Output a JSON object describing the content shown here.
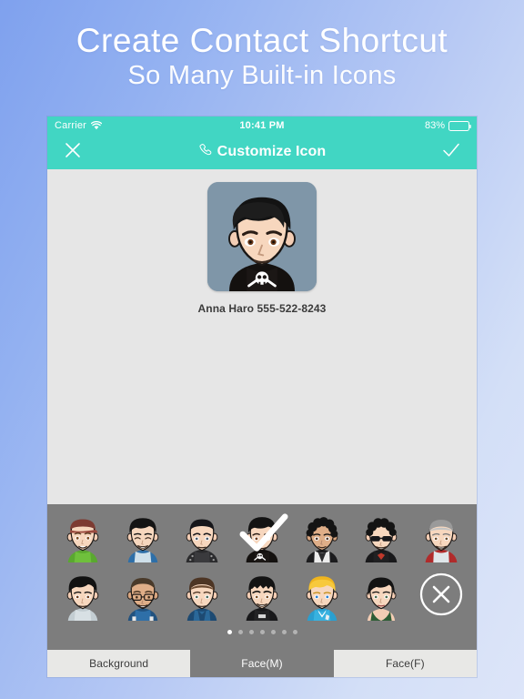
{
  "promo": {
    "line1": "Create Contact Shortcut",
    "line2": "So Many Built-in Icons"
  },
  "colors": {
    "nav_teal": "#41D6C3",
    "content_gray": "#E6E6E6",
    "picker_gray": "#7D7D7D",
    "tab_inactive": "#E8E8E6",
    "page_bg_start": "#7FA1EE",
    "page_bg_end": "#DDE5F9"
  },
  "statusbar": {
    "carrier": "Carrier",
    "wifi_icon": "wifi-icon",
    "time": "10:41 PM",
    "battery_percent": "83%",
    "battery_level": 83,
    "battery_icon": "battery-icon"
  },
  "navbar": {
    "close_icon": "close-icon",
    "title": "Customize Icon",
    "title_icon": "phone-handset-icon",
    "done_icon": "checkmark-icon"
  },
  "preview": {
    "label": "Anna Haro 555-522-8243",
    "avatar_name": "avatar-beanie-skull-tee",
    "background_color": "#7F96A8"
  },
  "picker": {
    "rows": [
      [
        {
          "name": "avatar-maroon-cap-green-shirt",
          "selected": false
        },
        {
          "name": "avatar-black-hair-blue-shirt",
          "selected": false
        },
        {
          "name": "avatar-buzzcut-black-jacket",
          "selected": false
        },
        {
          "name": "avatar-beanie-skull-tee",
          "selected": true
        },
        {
          "name": "avatar-curly-hair-white-jacket",
          "selected": false
        },
        {
          "name": "avatar-sunglasses-red-logo-tee",
          "selected": false
        },
        {
          "name": "avatar-gray-hair-red-raglan",
          "selected": false
        }
      ],
      [
        {
          "name": "avatar-black-hair-gray-shirt",
          "selected": false
        },
        {
          "name": "avatar-glasses-blue-shirt",
          "selected": false
        },
        {
          "name": "avatar-brown-hair-blue-collar",
          "selected": false
        },
        {
          "name": "avatar-spiky-hair-black-tee",
          "selected": false
        },
        {
          "name": "avatar-blonde-blue-polo",
          "selected": false
        },
        {
          "name": "avatar-female-green-tank",
          "selected": false
        },
        {
          "name": "clear-icon-button",
          "selected": false,
          "is_clear": true
        }
      ]
    ],
    "clear_button_icon": "circle-x-icon",
    "page_dots": {
      "count": 7,
      "active_index": 0
    }
  },
  "tabs": [
    {
      "label": "Background",
      "active": false,
      "name": "tab-background"
    },
    {
      "label": "Face(M)",
      "active": true,
      "name": "tab-face-male"
    },
    {
      "label": "Face(F)",
      "active": false,
      "name": "tab-face-female"
    }
  ]
}
